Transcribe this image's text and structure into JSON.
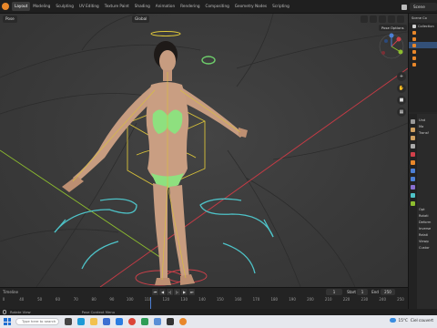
{
  "menubar": {
    "workspaces": [
      "Layout",
      "Modeling",
      "Sculpting",
      "UV Editing",
      "Texture Paint",
      "Shading",
      "Animation",
      "Rendering",
      "Compositing",
      "Geometry Nodes",
      "Scripting"
    ],
    "active_workspace": "Layout",
    "scene": "Scene"
  },
  "viewport": {
    "mode": "Pose",
    "orientation": "Global",
    "pose_options": "Pose Options"
  },
  "outliner": {
    "title": "Scene Co",
    "rows": [
      {
        "label": "Collection",
        "color": "#cfcfcf"
      },
      {
        "label": "",
        "color": "#e8872a"
      },
      {
        "label": "",
        "color": "#e8872a"
      },
      {
        "label": "",
        "color": "#e8872a"
      },
      {
        "label": "",
        "color": "#e8872a"
      },
      {
        "label": "",
        "color": "#e8872a"
      },
      {
        "label": "",
        "color": "#e8872a"
      }
    ]
  },
  "properties": {
    "rows": [
      "Und",
      "Ma",
      "Transf",
      "",
      "",
      "",
      "",
      "",
      "",
      "",
      "",
      "",
      "",
      "",
      "Opt",
      "Rotati",
      "Deform",
      "Inverse",
      "Relati",
      "Viewp",
      "Custor"
    ]
  },
  "timeline": {
    "label": "Timeline",
    "current_frame": "1",
    "start_label": "Start",
    "start": "1",
    "end_label": "End",
    "end": "250",
    "ticks": [
      "0",
      "40",
      "50",
      "60",
      "70",
      "80",
      "90",
      "100",
      "110",
      "120",
      "130",
      "140",
      "150",
      "160",
      "170",
      "180",
      "190",
      "200",
      "210",
      "220",
      "230",
      "240",
      "250"
    ]
  },
  "statusbar": {
    "left": "Rotate View",
    "context": "Pose Context Menu"
  },
  "taskbar": {
    "search_placeholder": "Type here to search",
    "weather": "15°C",
    "weather_desc": "Ciel couvert"
  },
  "colors": {
    "accent": "#4c7fd4",
    "bone_yellow": "#d9c23a",
    "bone_cyan": "#4ec3c8",
    "selection_green": "#8ee07f",
    "axis_x": "#d0404a",
    "axis_y": "#8dbd2f"
  }
}
